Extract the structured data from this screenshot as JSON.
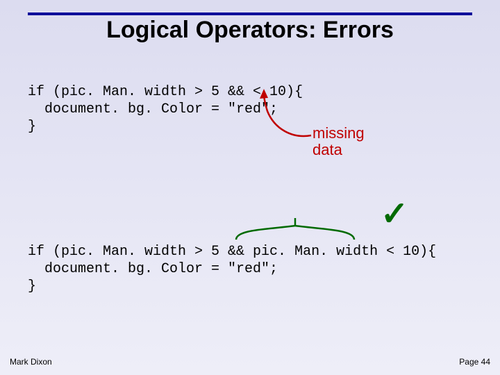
{
  "title": "Logical Operators: Errors",
  "code_block_1": {
    "line1": "if (pic. Man. width > 5 && < 10){",
    "line2": "  document. bg. Color = \"red\";",
    "line3": "}"
  },
  "annotation": {
    "line1": "missing",
    "line2": "data"
  },
  "checkmark": "✓",
  "code_block_2": {
    "line1": "if (pic. Man. width > 5 && pic. Man. width < 10){",
    "line2": "  document. bg. Color = \"red\";",
    "line3": "}"
  },
  "footer": {
    "author": "Mark Dixon",
    "page": "Page 44"
  }
}
